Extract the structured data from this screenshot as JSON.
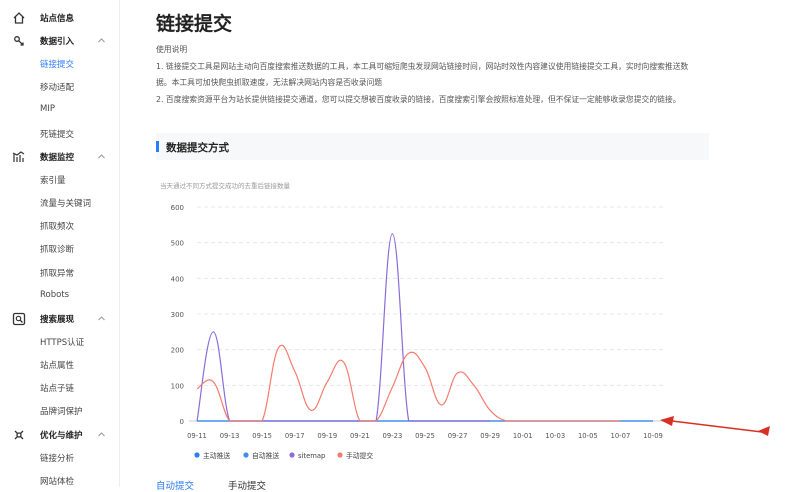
{
  "sidebar": {
    "home": {
      "label": "站点信息",
      "icon": "home-icon"
    },
    "groups": [
      {
        "label": "数据引入",
        "icon": "data-import-icon",
        "items": [
          "链接提交",
          "移动适配",
          "MIP",
          "死链提交"
        ],
        "active": 0
      },
      {
        "label": "数据监控",
        "icon": "chart-monitor-icon",
        "items": [
          "索引量",
          "流量与关键词",
          "抓取频次",
          "抓取诊断",
          "抓取异常",
          "Robots"
        ]
      },
      {
        "label": "搜索展现",
        "icon": "search-display-icon",
        "items": [
          "HTTPS认证",
          "站点属性",
          "站点子链",
          "品牌词保护"
        ]
      },
      {
        "label": "优化与维护",
        "icon": "optimize-icon",
        "items": [
          "链接分析",
          "网站体检"
        ]
      }
    ]
  },
  "main": {
    "title": "链接提交",
    "usage_heading": "使用说明",
    "usage_lines": [
      "1. 链接提交工具是网站主动向百度搜索推送数据的工具，本工具可缩短爬虫发现网站链接时间，网站时效性内容建议使用链接提交工具，实时向搜索推送数",
      "据。本工具可加快爬虫抓取速度，无法解决网站内容是否收录问题",
      "2. 百度搜索资源平台为站长提供链接提交通道，您可以提交想被百度收录的链接，百度搜索引擎会按照标准处理，但不保证一定能够收录您提交的链接。"
    ],
    "section_title": "数据提交方式",
    "chart_subtitle": "当天通过不同方式提交成功的去重后链接数量",
    "tabs": [
      "自动提交",
      "手动提交"
    ]
  },
  "colors": {
    "accent": "#2d7cf5",
    "zhudong": "#2d7cf5",
    "zidong": "#3c8fe8",
    "sitemap": "#8b6cd9",
    "shoudong": "#f47c6e",
    "arrow": "#d93026"
  },
  "chart_data": {
    "type": "line",
    "x": [
      "09-11",
      "09-12",
      "09-13",
      "09-14",
      "09-15",
      "09-16",
      "09-17",
      "09-18",
      "09-19",
      "09-20",
      "09-21",
      "09-22",
      "09-23",
      "09-24",
      "09-25",
      "09-26",
      "09-27",
      "09-28",
      "09-29",
      "09-30",
      "10-01",
      "10-02",
      "10-03",
      "10-04",
      "10-05",
      "10-06",
      "10-07",
      "10-08",
      "10-09"
    ],
    "x_tick_labels": [
      "09-11",
      "09-13",
      "09-15",
      "09-17",
      "09-19",
      "09-21",
      "09-23",
      "09-25",
      "09-27",
      "09-29",
      "10-01",
      "10-03",
      "10-05",
      "10-07",
      "10-09"
    ],
    "ylim": [
      0,
      600
    ],
    "y_ticks": [
      0,
      100,
      200,
      300,
      400,
      500,
      600
    ],
    "grid": true,
    "legend_position": "bottom-left",
    "series": [
      {
        "name": "主动推送",
        "values": [
          0,
          0,
          0,
          0,
          0,
          0,
          0,
          0,
          0,
          0,
          0,
          0,
          0,
          0,
          0,
          0,
          0,
          0,
          0,
          0,
          0,
          0,
          0,
          0,
          0,
          0,
          0,
          0,
          0
        ]
      },
      {
        "name": "自动推送",
        "values": [
          0,
          0,
          0,
          0,
          0,
          0,
          0,
          0,
          0,
          0,
          0,
          0,
          0,
          0,
          0,
          0,
          0,
          0,
          0,
          0,
          0,
          0,
          0,
          0,
          0,
          0,
          0,
          0,
          0
        ]
      },
      {
        "name": "sitemap",
        "values": [
          0,
          250,
          0,
          0,
          0,
          0,
          0,
          0,
          0,
          0,
          0,
          0,
          525,
          0,
          0,
          0,
          0,
          0,
          0,
          0,
          0,
          0,
          0,
          0,
          0,
          0,
          0,
          0,
          0
        ]
      },
      {
        "name": "手动提交",
        "values": [
          90,
          110,
          0,
          0,
          0,
          205,
          140,
          30,
          110,
          165,
          0,
          0,
          95,
          190,
          150,
          45,
          135,
          100,
          30,
          0,
          0,
          0,
          0,
          0,
          0,
          0,
          0,
          0,
          0
        ]
      }
    ]
  }
}
